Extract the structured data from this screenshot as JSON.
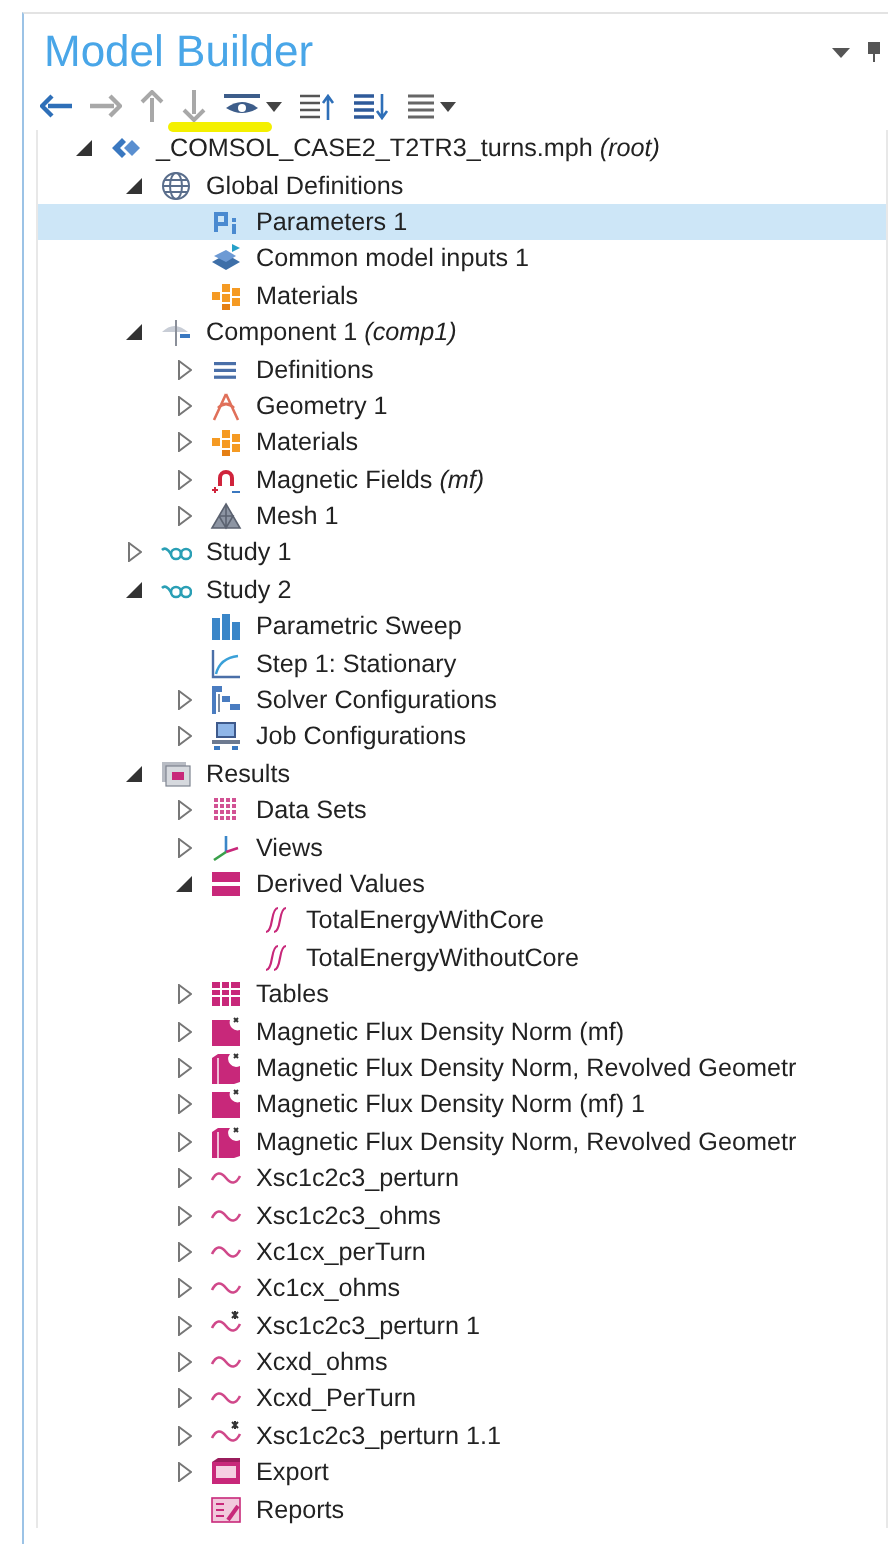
{
  "panel": {
    "title": "Model Builder"
  },
  "toolbar": [
    {
      "kind": "back",
      "disabled": false
    },
    {
      "kind": "forward",
      "disabled": true
    },
    {
      "kind": "up",
      "disabled": true
    },
    {
      "kind": "down",
      "disabled": true
    },
    {
      "kind": "eye-menu",
      "disabled": false
    },
    {
      "kind": "collapse",
      "disabled": false
    },
    {
      "kind": "expand",
      "disabled": false
    },
    {
      "kind": "list-menu",
      "disabled": false
    }
  ],
  "tree": [
    {
      "label": "_COMSOL_CASE2_T2TR3_turns.mph *(root)*",
      "kind": "model",
      "expanded": true,
      "selected": false,
      "children": [
        {
          "label": "Global Definitions",
          "kind": "globe",
          "expanded": true,
          "selected": false,
          "children": [
            {
              "label": "Parameters 1",
              "kind": "parameters",
              "selected": true
            },
            {
              "label": "Common model inputs 1",
              "kind": "inputs",
              "selected": false
            },
            {
              "label": "Materials",
              "kind": "materials",
              "selected": false
            }
          ]
        },
        {
          "label": "Component 1 *(comp1)*",
          "kind": "component",
          "expanded": true,
          "selected": false,
          "children": [
            {
              "label": "Definitions",
              "kind": "definitions",
              "expanded": false,
              "selected": false
            },
            {
              "label": "Geometry 1",
              "kind": "geometry",
              "expanded": false,
              "selected": false
            },
            {
              "label": "Materials",
              "kind": "materials",
              "expanded": false,
              "selected": false
            },
            {
              "label": "Magnetic Fields *(mf)*",
              "kind": "magnet",
              "expanded": false,
              "selected": false
            },
            {
              "label": "Mesh 1",
              "kind": "mesh",
              "expanded": false,
              "selected": false
            }
          ]
        },
        {
          "label": "Study 1",
          "kind": "study",
          "expanded": false,
          "selected": false
        },
        {
          "label": "Study 2",
          "kind": "study",
          "expanded": true,
          "selected": false,
          "children": [
            {
              "label": "Parametric Sweep",
              "kind": "sweep",
              "selected": false
            },
            {
              "label": "Step 1: Stationary",
              "kind": "step",
              "selected": false
            },
            {
              "label": "Solver Configurations",
              "kind": "solver",
              "expanded": false,
              "selected": false
            },
            {
              "label": "Job Configurations",
              "kind": "job",
              "expanded": false,
              "selected": false
            }
          ]
        },
        {
          "label": "Results",
          "kind": "results",
          "expanded": true,
          "selected": false,
          "children": [
            {
              "label": "Data Sets",
              "kind": "datasets",
              "expanded": false,
              "selected": false
            },
            {
              "label": "Views",
              "kind": "views",
              "expanded": false,
              "selected": false
            },
            {
              "label": "Derived Values",
              "kind": "derived",
              "expanded": true,
              "selected": false,
              "children": [
                {
                  "label": "TotalEnergyWithCore",
                  "kind": "integral",
                  "selected": false
                },
                {
                  "label": "TotalEnergyWithoutCore",
                  "kind": "integral",
                  "selected": false
                }
              ]
            },
            {
              "label": "Tables",
              "kind": "tables",
              "expanded": false,
              "selected": false
            },
            {
              "label": "Magnetic Flux Density Norm (mf)",
              "kind": "plot",
              "expanded": false,
              "selected": false
            },
            {
              "label": "Magnetic Flux Density Norm, Revolved Geometr",
              "kind": "revolved",
              "expanded": false,
              "selected": false
            },
            {
              "label": "Magnetic Flux Density Norm (mf) 1",
              "kind": "plot",
              "expanded": false,
              "selected": false
            },
            {
              "label": "Magnetic Flux Density Norm, Revolved Geometr",
              "kind": "revolved",
              "expanded": false,
              "selected": false
            },
            {
              "label": "Xsc1c2c3_perturn",
              "kind": "wave",
              "expanded": false,
              "selected": false
            },
            {
              "label": "Xsc1c2c3_ohms",
              "kind": "wave",
              "expanded": false,
              "selected": false
            },
            {
              "label": "Xc1cx_perTurn",
              "kind": "wave",
              "expanded": false,
              "selected": false
            },
            {
              "label": "Xc1cx_ohms",
              "kind": "wave",
              "expanded": false,
              "selected": false
            },
            {
              "label": "Xsc1c2c3_perturn 1",
              "kind": "wave-star",
              "expanded": false,
              "selected": false
            },
            {
              "label": "Xcxd_ohms",
              "kind": "wave",
              "expanded": false,
              "selected": false
            },
            {
              "label": "Xcxd_PerTurn",
              "kind": "wave",
              "expanded": false,
              "selected": false
            },
            {
              "label": "Xsc1c2c3_perturn 1.1",
              "kind": "wave-star",
              "expanded": false,
              "selected": false
            },
            {
              "label": "Export",
              "kind": "export",
              "expanded": false,
              "selected": false
            },
            {
              "label": "Reports",
              "kind": "reports",
              "selected": false
            }
          ]
        }
      ]
    }
  ]
}
